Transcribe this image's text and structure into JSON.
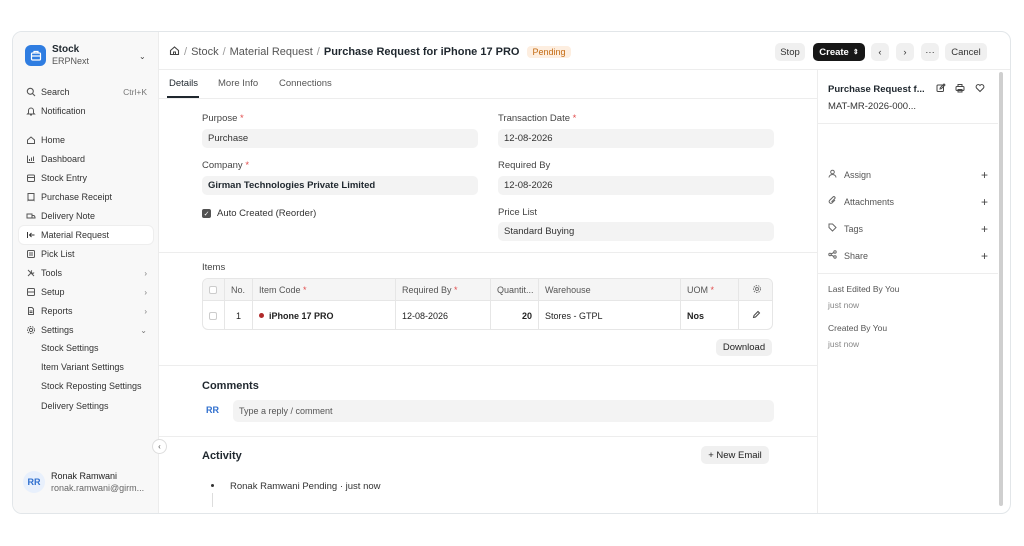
{
  "sidebar": {
    "app_name": "Stock",
    "app_sub": "ERPNext",
    "search_label": "Search",
    "search_shortcut": "Ctrl+K",
    "notification_label": "Notification",
    "items": [
      {
        "label": "Home"
      },
      {
        "label": "Dashboard"
      },
      {
        "label": "Stock Entry"
      },
      {
        "label": "Purchase Receipt"
      },
      {
        "label": "Delivery Note"
      },
      {
        "label": "Material Request"
      },
      {
        "label": "Pick List"
      },
      {
        "label": "Tools"
      },
      {
        "label": "Setup"
      },
      {
        "label": "Reports"
      },
      {
        "label": "Settings"
      }
    ],
    "sub_items": [
      "Stock Settings",
      "Item Variant Settings",
      "Stock Reposting Settings",
      "Delivery Settings"
    ],
    "user_initials": "RR",
    "user_name": "Ronak Ramwani",
    "user_email": "ronak.ramwani@girm..."
  },
  "header": {
    "crumbs": [
      "Stock",
      "Material Request",
      "Purchase Request for iPhone 17 PRO"
    ],
    "status": "Pending",
    "stop_label": "Stop",
    "create_label": "Create",
    "more_label": "···",
    "cancel_label": "Cancel"
  },
  "tabs": [
    "Details",
    "More Info",
    "Connections"
  ],
  "form": {
    "purpose_label": "Purpose",
    "purpose_value": "Purchase",
    "company_label": "Company",
    "company_value": "Girman Technologies Private Limited",
    "auto_created_label": "Auto Created (Reorder)",
    "auto_created_checked": true,
    "transaction_date_label": "Transaction Date",
    "transaction_date_value": "12-08-2026",
    "required_by_label": "Required By",
    "required_by_value": "12-08-2026",
    "price_list_label": "Price List",
    "price_list_value": "Standard Buying"
  },
  "items": {
    "section_label": "Items",
    "columns": [
      "No.",
      "Item Code",
      "Required By",
      "Quantit...",
      "Warehouse",
      "UOM"
    ],
    "rows": [
      {
        "no": "1",
        "item_code": "iPhone 17 PRO",
        "required_by": "12-08-2026",
        "qty": "20",
        "warehouse": "Stores - GTPL",
        "uom": "Nos"
      }
    ],
    "download_label": "Download"
  },
  "comments": {
    "title": "Comments",
    "initials": "RR",
    "placeholder": "Type a reply / comment"
  },
  "activity": {
    "title": "Activity",
    "new_email_label": "+ New Email",
    "entry": "Ronak Ramwani Pending · just now"
  },
  "right_panel": {
    "title": "Purchase Request f...",
    "doc_id": "MAT-MR-2026-000...",
    "assign_label": "Assign",
    "attachments_label": "Attachments",
    "tags_label": "Tags",
    "share_label": "Share",
    "last_edited_label": "Last Edited By You",
    "last_edited_time": "just now",
    "created_label": "Created By You",
    "created_time": "just now"
  }
}
